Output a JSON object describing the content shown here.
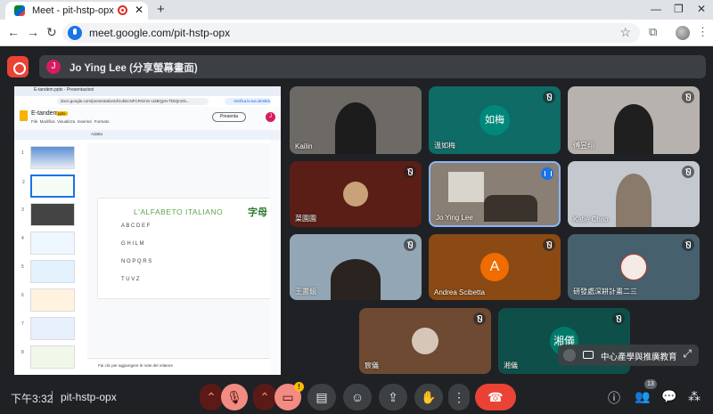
{
  "browser": {
    "tab_title": "Meet - pit-hstp-opx",
    "url": "meet.google.com/pit-hstp-opx"
  },
  "banner": {
    "initial": "J",
    "text": "Jo Ying Lee (分享螢幕畫面)"
  },
  "shared_screen": {
    "tab_title": "E-tandem.pptx - Presentazioni",
    "url": "docs.google.com/presentation/d/1vbEcNFCRSmG-U2BQpN-TbkQnG5...",
    "profile_pill": "Verifica la tua identità",
    "doc_title": "E-tandem",
    "doc_badge": "pptx",
    "menu": [
      "File",
      "Modifica",
      "Visualizza",
      "Inserisci",
      "Formato"
    ],
    "present_button": "Presenta",
    "user_initial": "J",
    "zoom": "Adatta",
    "slide_numbers": [
      "1",
      "2",
      "3",
      "4",
      "5",
      "6",
      "7",
      "8"
    ],
    "slide_title": "L'ALFABETO ITALIANO",
    "slide_cjk": "字母",
    "alphabet_rows": [
      "A   B   C   D   E   F",
      "G   H   I   L   M",
      "N   O   P   Q   R   S",
      "T   U   V   Z"
    ],
    "notes_placeholder": "Fai clic per aggiungere le note del relatore"
  },
  "participants": [
    {
      "name": "Kailin"
    },
    {
      "name": "溫如梅",
      "avatar_text": "如梅",
      "avatar_color": "#00897b"
    },
    {
      "name": "傅昱翔"
    },
    {
      "name": "菜園園"
    },
    {
      "name": "Jo Ying Lee"
    },
    {
      "name": "Katie Chao"
    },
    {
      "name": "王書鏡"
    },
    {
      "name": "Andrea Scibetta",
      "avatar_text": "A",
      "avatar_color": "#ef6c00"
    },
    {
      "name": "研發處深耕計畫二三"
    },
    {
      "name": "宸儀"
    },
    {
      "name": "湘儀",
      "avatar_text": "湘儀",
      "avatar_color": "#00796b"
    }
  ],
  "overlay": {
    "label": "中心產學與推廣教育"
  },
  "bottom": {
    "time": "下午3:32",
    "meeting_code": "pit-hstp-opx",
    "participant_count": "13",
    "warning": "!"
  },
  "colors": {
    "end_call": "#ea4335",
    "accent": "#1a73e8",
    "mic_off": "#f28b82"
  }
}
